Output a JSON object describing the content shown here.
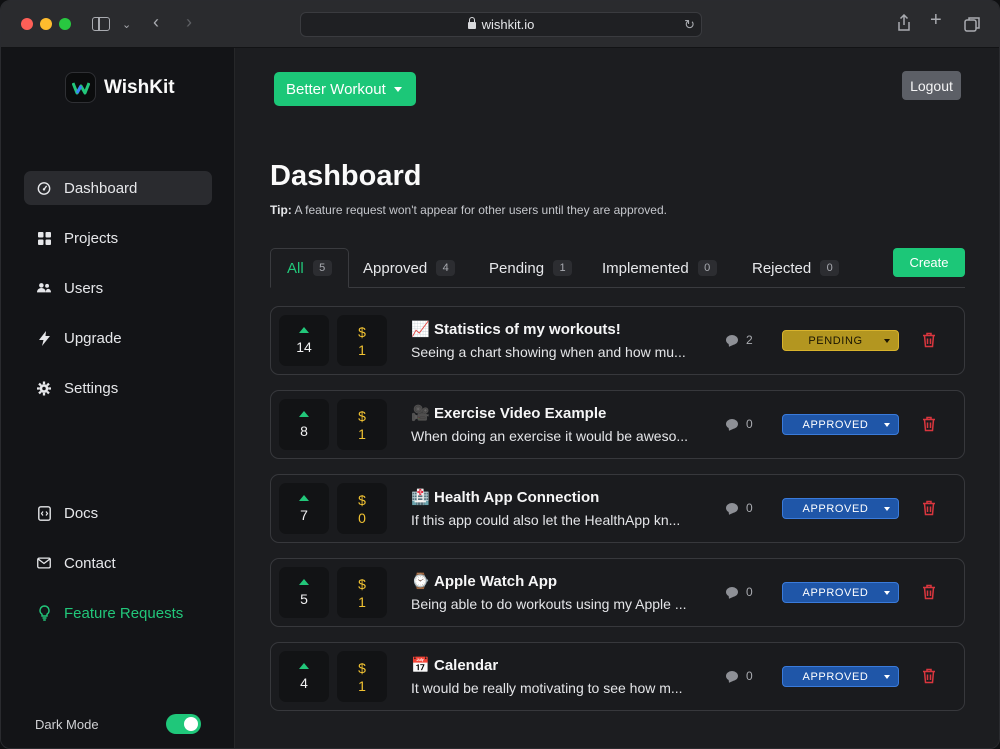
{
  "browser": {
    "url": "wishkit.io"
  },
  "sidebar": {
    "brand": "WishKit",
    "items": [
      {
        "label": "Dashboard",
        "icon": "gauge-icon",
        "active": true
      },
      {
        "label": "Projects",
        "icon": "grid-icon"
      },
      {
        "label": "Users",
        "icon": "users-icon"
      },
      {
        "label": "Upgrade",
        "icon": "bolt-icon"
      },
      {
        "label": "Settings",
        "icon": "gear-icon"
      }
    ],
    "bottom_items": [
      {
        "label": "Docs",
        "icon": "docs-icon"
      },
      {
        "label": "Contact",
        "icon": "envelope-icon"
      },
      {
        "label": "Feature Requests",
        "icon": "lightbulb-icon"
      }
    ],
    "dark_mode_label": "Dark Mode",
    "dark_mode_on": true
  },
  "header": {
    "project": "Better Workout",
    "logout": "Logout"
  },
  "main": {
    "title": "Dashboard",
    "tip_label": "Tip:",
    "tip_text": " A feature request won't appear for other users until they are approved.",
    "create": "Create",
    "tabs": [
      {
        "label": "All",
        "count": "5",
        "active": true
      },
      {
        "label": "Approved",
        "count": "4"
      },
      {
        "label": "Pending",
        "count": "1"
      },
      {
        "label": "Implemented",
        "count": "0"
      },
      {
        "label": "Rejected",
        "count": "0"
      }
    ],
    "requests": [
      {
        "votes": "14",
        "price_symbol": "$",
        "price": "1",
        "emoji": "📈",
        "title": "Statistics of my workouts!",
        "description": "Seeing a chart showing when and how mu...",
        "comments": "2",
        "status": "PENDING"
      },
      {
        "votes": "8",
        "price_symbol": "$",
        "price": "1",
        "emoji": "🎥",
        "title": "Exercise Video Example",
        "description": "When doing an exercise it would be aweso...",
        "comments": "0",
        "status": "APPROVED"
      },
      {
        "votes": "7",
        "price_symbol": "$",
        "price": "0",
        "emoji": "🏥",
        "title": "Health App Connection",
        "description": "If this app could also let the HealthApp kn...",
        "comments": "0",
        "status": "APPROVED"
      },
      {
        "votes": "5",
        "price_symbol": "$",
        "price": "1",
        "emoji": "⌚",
        "title": "Apple Watch App",
        "description": "Being able to do workouts using my Apple ...",
        "comments": "0",
        "status": "APPROVED"
      },
      {
        "votes": "4",
        "price_symbol": "$",
        "price": "1",
        "emoji": "📅",
        "title": "Calendar",
        "description": "It would be really motivating to see how m...",
        "comments": "0",
        "status": "APPROVED"
      }
    ]
  },
  "colors": {
    "accent": "#1cc778",
    "pending": "#b39620",
    "approved": "#1f56a8",
    "delete": "#d9363e"
  }
}
